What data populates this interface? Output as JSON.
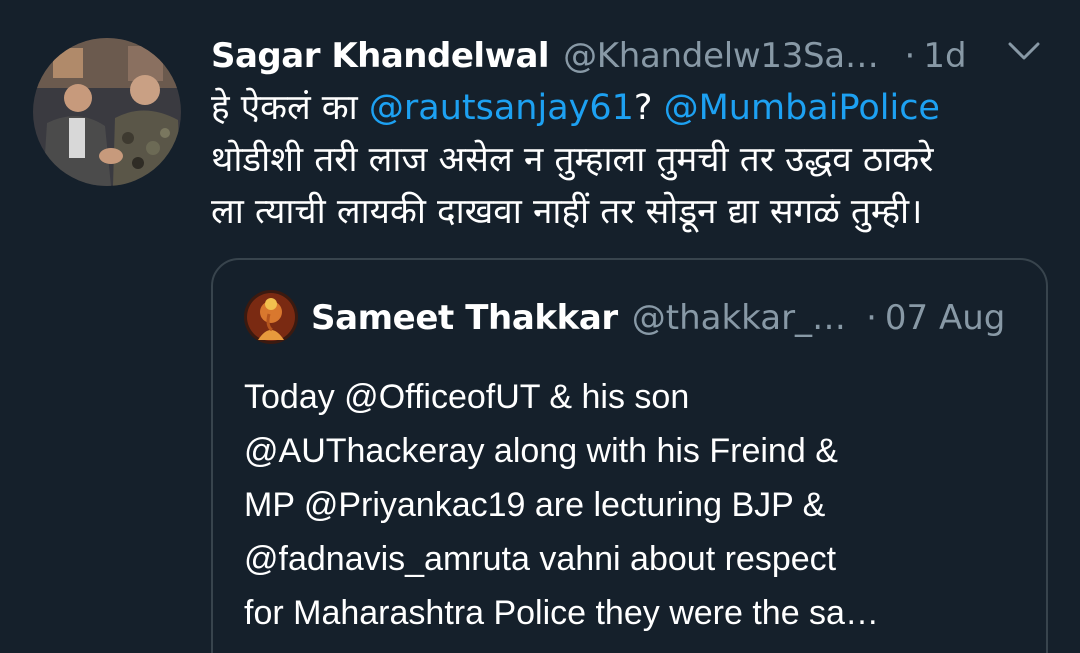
{
  "tweet": {
    "author_name": "Sagar Khandelwal",
    "author_handle": "@Khandelw13Sa…",
    "separator": "·",
    "time": "1d",
    "menu_icon": "chevron-down-icon",
    "text_line1_prefix": "हे ऐकलं का ",
    "mention1": "@rautsanjay61",
    "text_line1_mid": "? ",
    "mention2": "@MumbaiPolice",
    "text_line2": "थोडीशी तरी लाज असेल न तुम्हाला तुमची तर उद्धव ठाकरे",
    "text_line3": "ला त्याची लायकी दाखवा नाहीं तर सोडून द्या सगळं तुम्ही।"
  },
  "quoted": {
    "author_name": "Sameet Thakkar",
    "author_handle": "@thakkar_…",
    "separator": "·",
    "time": "07 Aug",
    "lines": [
      "Today @OfficeofUT & his son",
      "@AUThackeray along with his Freind &",
      "MP @Priyankac19 are lecturing BJP &",
      "@fadnavis_amruta vahni about respect",
      "for Maharashtra Police they were the sa…"
    ]
  },
  "colors": {
    "background": "#15202b",
    "text": "#ffffff",
    "secondary": "#8899a6",
    "accent": "#1da1f2",
    "border": "#38444d"
  }
}
